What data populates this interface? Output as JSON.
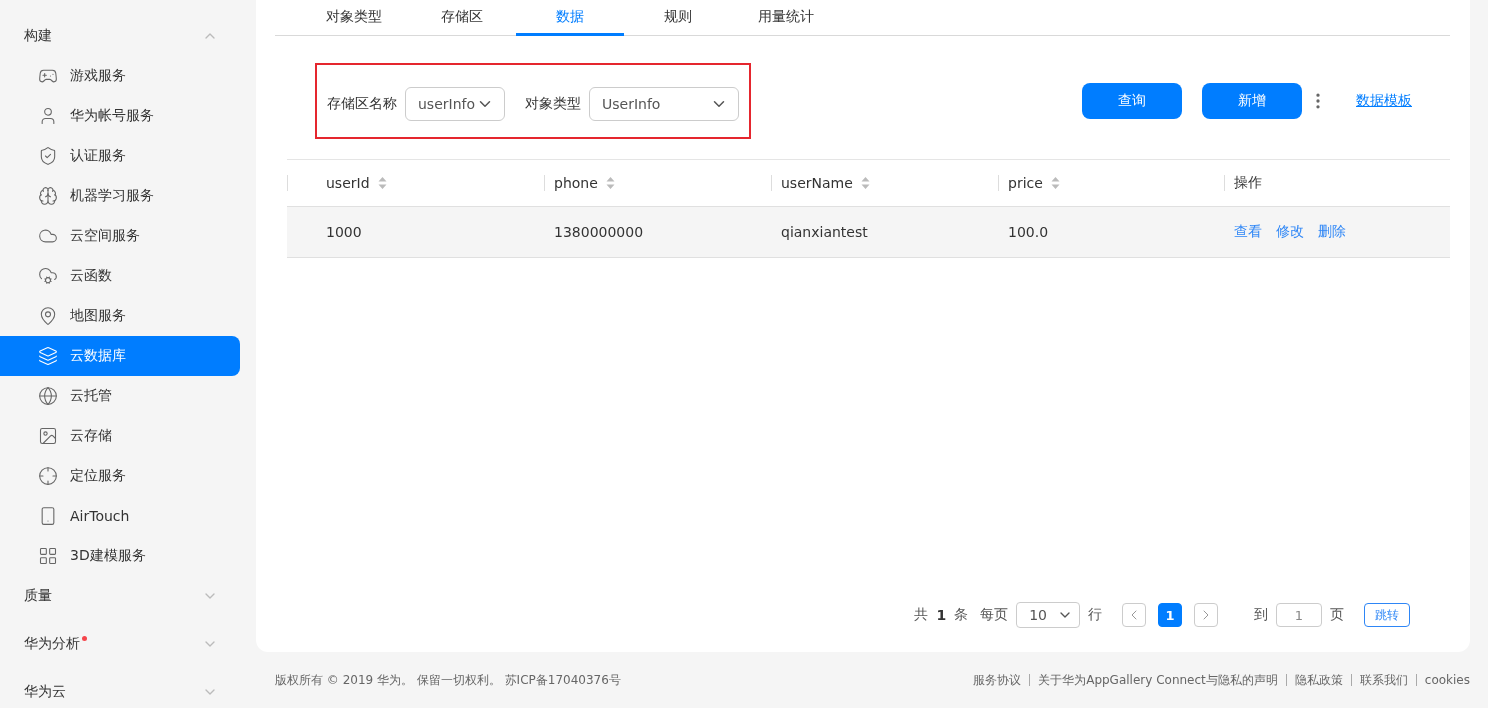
{
  "sidebar": {
    "sections": [
      {
        "label": "构建",
        "expanded": true,
        "dot": false,
        "items": [
          {
            "label": "游戏服务",
            "selected": false
          },
          {
            "label": "华为帐号服务",
            "selected": false
          },
          {
            "label": "认证服务",
            "selected": false
          },
          {
            "label": "机器学习服务",
            "selected": false
          },
          {
            "label": "云空间服务",
            "selected": false
          },
          {
            "label": "云函数",
            "selected": false
          },
          {
            "label": "地图服务",
            "selected": false
          },
          {
            "label": "云数据库",
            "selected": true
          },
          {
            "label": "云托管",
            "selected": false
          },
          {
            "label": "云存储",
            "selected": false
          },
          {
            "label": "定位服务",
            "selected": false
          },
          {
            "label": "AirTouch",
            "selected": false
          },
          {
            "label": "3D建模服务",
            "selected": false
          }
        ]
      },
      {
        "label": "质量",
        "expanded": false,
        "dot": false
      },
      {
        "label": "华为分析",
        "expanded": false,
        "dot": true
      },
      {
        "label": "华为云",
        "expanded": false,
        "dot": false
      }
    ]
  },
  "tabs": [
    {
      "label": "对象类型",
      "selected": false
    },
    {
      "label": "存储区",
      "selected": false
    },
    {
      "label": "数据",
      "selected": true
    },
    {
      "label": "规则",
      "selected": false
    },
    {
      "label": "用量统计",
      "selected": false
    }
  ],
  "filters": [
    {
      "label": "存储区名称",
      "value": "userInfo"
    },
    {
      "label": "对象类型",
      "value": "UserInfo"
    }
  ],
  "buttons": [
    "查询",
    "新增"
  ],
  "template_link": "数据模板",
  "table": {
    "columns": [
      {
        "label": "userId",
        "sortable": true
      },
      {
        "label": "phone",
        "sortable": true
      },
      {
        "label": "userName",
        "sortable": true
      },
      {
        "label": "price",
        "sortable": true
      },
      {
        "label": "操作",
        "sortable": false
      }
    ],
    "rows": [
      {
        "cells": [
          "1000",
          "1380000000",
          "qianxiantest",
          "100.0"
        ],
        "actions": [
          "查看",
          "修改",
          "删除"
        ]
      }
    ]
  },
  "pagination": {
    "total_prefix": "共",
    "total": "1",
    "total_suffix": "条",
    "per_page_label": "每页",
    "per_page": "10",
    "rows_label": "行",
    "pages": [
      {
        "label": "1",
        "selected": true
      }
    ],
    "goto_label": "到",
    "goto_value": "1",
    "page_label": "页",
    "jump": "跳转"
  },
  "footer": {
    "copyright": "版权所有 © 2019 华为。 保留一切权利。 苏ICP备17040376号",
    "links": [
      "服务协议",
      "关于华为AppGallery Connect与隐私的声明",
      "隐私政策",
      "联系我们",
      "cookies"
    ]
  }
}
